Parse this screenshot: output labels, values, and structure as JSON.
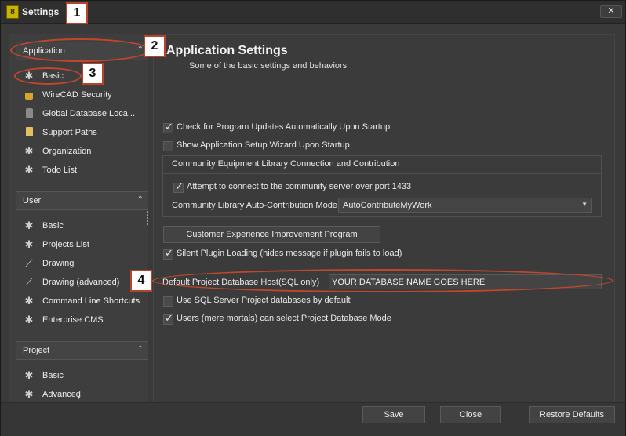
{
  "window": {
    "title": "Settings",
    "app_icon_label": "8",
    "close_label": "✕"
  },
  "sidebar": {
    "sections": [
      {
        "label": "Application",
        "items": [
          "Basic",
          "WireCAD Security",
          "Global Database Loca...",
          "Support Paths",
          "Organization",
          "Todo List"
        ]
      },
      {
        "label": "User",
        "items": [
          "Basic",
          "Projects List",
          "Drawing",
          "Drawing (advanced)",
          "Command Line Shortcuts",
          "Enterprise CMS"
        ]
      },
      {
        "label": "Project",
        "items": [
          "Basic",
          "Advanced"
        ]
      }
    ],
    "chevron": "⌃"
  },
  "main": {
    "title": "Application Settings",
    "subtitle": "Some of the basic settings and behaviors",
    "check_updates": {
      "label": "Check for Program Updates Automatically Upon Startup",
      "checked": true
    },
    "show_wizard": {
      "label": "Show Application Setup Wizard Upon Startup",
      "checked": false
    },
    "community_group": {
      "title": "Community Equipment Library Connection and Contribution",
      "attempt_connect": {
        "label": "Attempt to connect to the community server over port 1433",
        "checked": true
      },
      "mode_label": "Community Library Auto-Contribution Mode",
      "mode_value": "AutoContributeMyWork"
    },
    "ceip_button": "Customer Experience Improvement Program",
    "silent_plugin": {
      "label": "Silent Plugin Loading (hides message if plugin fails to load)",
      "checked": true
    },
    "db_host_label": "Default Project Database Host(SQL only)",
    "db_host_value": "YOUR DATABASE NAME GOES HERE",
    "use_sql": {
      "label": "Use SQL Server Project databases by default",
      "checked": false
    },
    "users_select": {
      "label": "Users (mere mortals) can select Project Database Mode",
      "checked": true
    }
  },
  "footer": {
    "save": "Save",
    "close": "Close",
    "restore": "Restore Defaults"
  },
  "callouts": [
    "1",
    "2",
    "3",
    "4"
  ],
  "colors": {
    "callout_border": "#b4442a",
    "ring": "#c0462c",
    "background": "#3a3a3a"
  }
}
